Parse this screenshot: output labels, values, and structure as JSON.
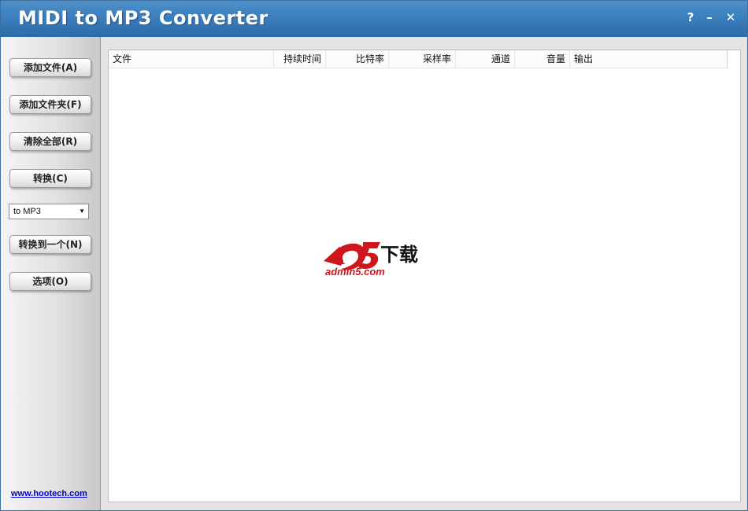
{
  "window": {
    "title": "MIDI to MP3 Converter",
    "help_glyph": "?",
    "min_glyph": "–",
    "close_glyph": "✕"
  },
  "sidebar": {
    "buttons": [
      {
        "label": "添加文件(A)"
      },
      {
        "label": "添加文件夹(F)"
      },
      {
        "label": "清除全部(R)"
      },
      {
        "label": "转换(C)"
      },
      {
        "label": "转换到一个(N)"
      },
      {
        "label": "选项(O)"
      }
    ],
    "format_select": {
      "value": "to MP3"
    },
    "link": "www.hootech.com"
  },
  "table": {
    "columns": [
      "文件",
      "持续时间",
      "比特率",
      "采样率",
      "通道",
      "音量",
      "输出"
    ]
  },
  "watermark": {
    "text": "下载",
    "site": "admin5.com"
  },
  "colors": {
    "titlebar": "#3c7fbe",
    "link": "#0000cc",
    "watermark_red": "#d0161d"
  }
}
